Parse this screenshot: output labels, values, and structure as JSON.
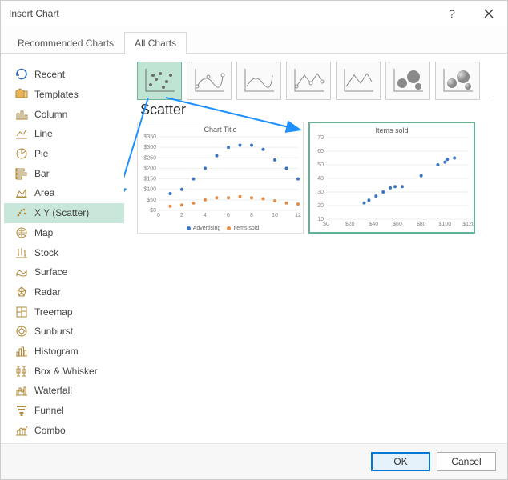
{
  "titlebar": {
    "title": "Insert Chart"
  },
  "tabs": {
    "recommended": "Recommended Charts",
    "all": "All Charts"
  },
  "sidebar": {
    "items": [
      {
        "label": "Recent",
        "icon": "recent"
      },
      {
        "label": "Templates",
        "icon": "templates"
      },
      {
        "label": "Column",
        "icon": "column"
      },
      {
        "label": "Line",
        "icon": "line"
      },
      {
        "label": "Pie",
        "icon": "pie"
      },
      {
        "label": "Bar",
        "icon": "bar"
      },
      {
        "label": "Area",
        "icon": "area"
      },
      {
        "label": "X Y (Scatter)",
        "icon": "scatter"
      },
      {
        "label": "Map",
        "icon": "map"
      },
      {
        "label": "Stock",
        "icon": "stock"
      },
      {
        "label": "Surface",
        "icon": "surface"
      },
      {
        "label": "Radar",
        "icon": "radar"
      },
      {
        "label": "Treemap",
        "icon": "treemap"
      },
      {
        "label": "Sunburst",
        "icon": "sunburst"
      },
      {
        "label": "Histogram",
        "icon": "histogram"
      },
      {
        "label": "Box & Whisker",
        "icon": "boxwhisker"
      },
      {
        "label": "Waterfall",
        "icon": "waterfall"
      },
      {
        "label": "Funnel",
        "icon": "funnel"
      },
      {
        "label": "Combo",
        "icon": "combo"
      }
    ],
    "selected_index": 7
  },
  "subtype_title": "Scatter",
  "previews": {
    "left": {
      "title": "Chart Title",
      "legend": {
        "series1": "Advertising",
        "series2": "Items sold"
      }
    },
    "right": {
      "title": "Items sold"
    }
  },
  "footer": {
    "ok": "OK",
    "cancel": "Cancel"
  },
  "chart_data": [
    {
      "type": "scatter",
      "title": "Chart Title",
      "x": [
        0,
        2,
        4,
        6,
        8,
        10,
        12
      ],
      "xticks": [
        0,
        2,
        4,
        6,
        8,
        10,
        12
      ],
      "ylabel_prefix": "$",
      "yticks": [
        0,
        50,
        100,
        150,
        200,
        250,
        300,
        350
      ],
      "series": [
        {
          "name": "Advertising",
          "color": "#3b76c4",
          "x": [
            1,
            2,
            3,
            4,
            5,
            6,
            7,
            8,
            9,
            10,
            11,
            12
          ],
          "y": [
            80,
            100,
            150,
            200,
            260,
            300,
            310,
            310,
            290,
            240,
            200,
            150
          ]
        },
        {
          "name": "Items sold",
          "color": "#e48b45",
          "x": [
            1,
            2,
            3,
            4,
            5,
            6,
            7,
            8,
            9,
            10,
            11,
            12
          ],
          "y": [
            20,
            25,
            35,
            50,
            60,
            60,
            65,
            60,
            55,
            45,
            35,
            30
          ]
        }
      ],
      "xlabel": "",
      "ylabel": ""
    },
    {
      "type": "scatter",
      "title": "Items sold",
      "xticks": [
        0,
        20,
        40,
        60,
        80,
        100,
        120
      ],
      "yticks": [
        10,
        20,
        30,
        40,
        50,
        60,
        70
      ],
      "xlabel_prefix": "$",
      "series": [
        {
          "name": "",
          "color": "#3b76c4",
          "x": [
            32,
            36,
            42,
            48,
            54,
            58,
            64,
            80,
            94,
            100,
            102,
            108
          ],
          "y": [
            22,
            24,
            27,
            30,
            33,
            34,
            34,
            42,
            50,
            52,
            54,
            55
          ]
        }
      ],
      "xlabel": "",
      "ylabel": ""
    }
  ]
}
